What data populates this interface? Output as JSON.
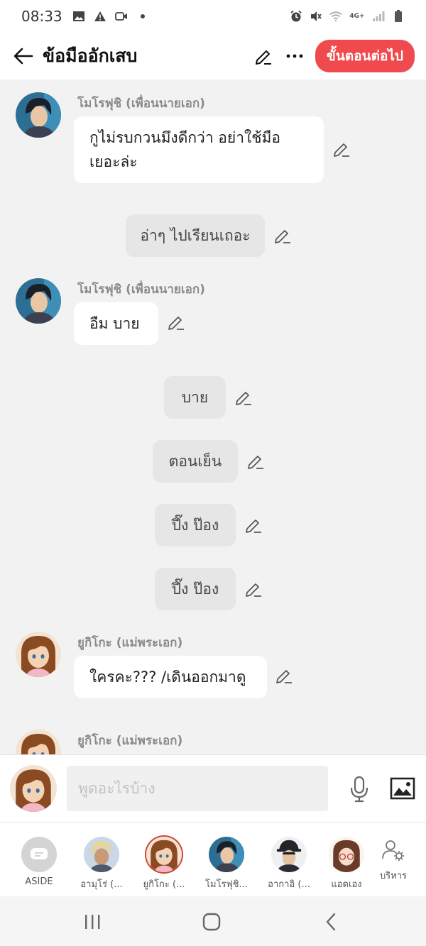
{
  "status_bar": {
    "time": "08:33",
    "network": "4G+"
  },
  "header": {
    "title": "ข้อมืออักเสบ",
    "next_button": "ขั้นตอนต่อไป"
  },
  "messages": [
    {
      "type": "character",
      "sender": "โมโรฟุชิ (เพื่อนนายเอก)",
      "avatar": "morofushi",
      "lines": [
        "กูไม่รบกวนมึงดีกว่า อย่าใช้มือ",
        "เยอะล่ะ"
      ]
    },
    {
      "type": "narration",
      "text": "อ่าๆ ไปเรียนเถอะ"
    },
    {
      "type": "character",
      "sender": "โมโรฟุชิ (เพื่อนนายเอก)",
      "avatar": "morofushi",
      "lines": [
        "อืม บาย"
      ]
    },
    {
      "type": "narration",
      "text": "บาย"
    },
    {
      "type": "narration",
      "text": "ตอนเย็น"
    },
    {
      "type": "narration",
      "text": "ปึ๊ง ป๊อง"
    },
    {
      "type": "narration",
      "text": "ปึ๊ง ป๊อง"
    },
    {
      "type": "character",
      "sender": "ยูกิโกะ (แม่พระเอก)",
      "avatar": "yukiko",
      "lines": [
        "ใครคะ??? /เดินออกมาดู"
      ]
    },
    {
      "type": "character",
      "sender": "ยูกิโกะ (แม่พระเอก)",
      "avatar": "yukiko",
      "lines": []
    }
  ],
  "composer": {
    "placeholder": "พูดอะไรบ้าง"
  },
  "cast": [
    {
      "label": "ASIDE",
      "avatar": "aside"
    },
    {
      "label": "อามุโร่ (...",
      "avatar": "amuro"
    },
    {
      "label": "ยูกิโกะ (...",
      "avatar": "yukiko"
    },
    {
      "label": "โมโรฟุชิ...",
      "avatar": "morofushi"
    },
    {
      "label": "อากาอิ (...",
      "avatar": "akai"
    },
    {
      "label": "แอดเอง",
      "avatar": "admin"
    },
    {
      "label": "บริหาร",
      "avatar": "manage-icon"
    }
  ],
  "colors": {
    "accent": "#f04a4f",
    "background": "#f2f2f2",
    "narration_bubble": "#e6e6e6"
  }
}
